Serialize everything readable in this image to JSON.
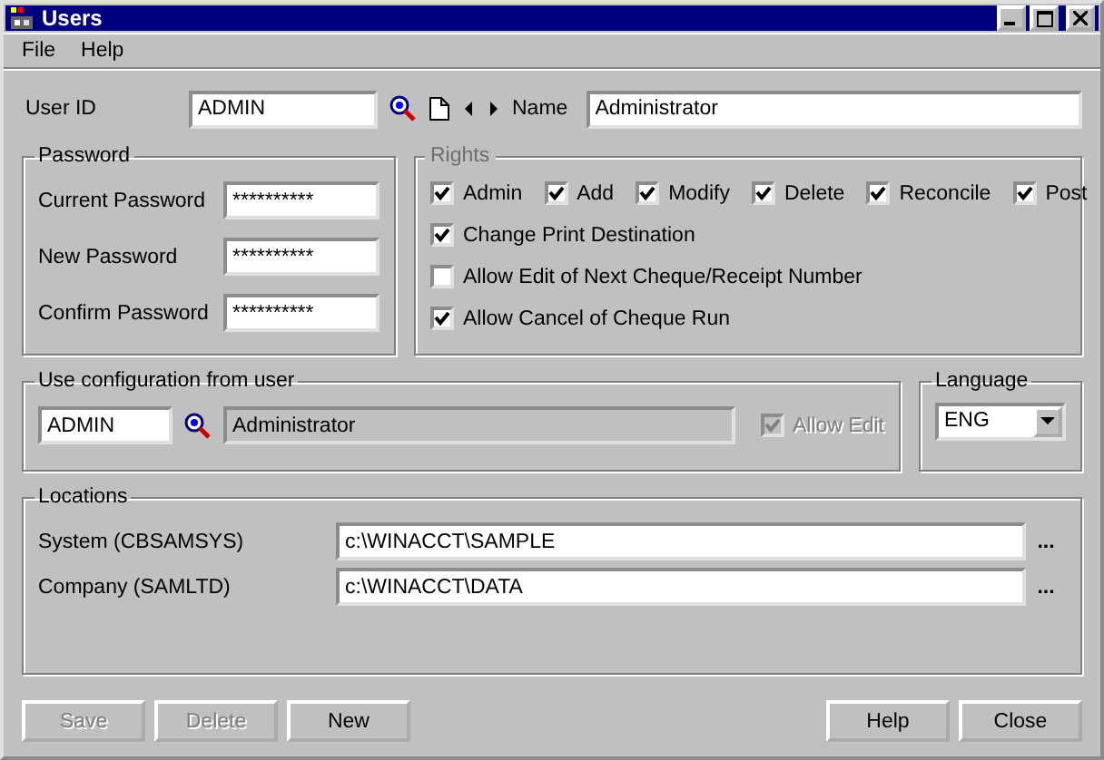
{
  "window": {
    "title": "Users"
  },
  "menu": [
    {
      "label": "File"
    },
    {
      "label": "Help"
    }
  ],
  "user": {
    "label": "User ID",
    "value": "ADMIN",
    "name_label": "Name",
    "name_value": "Administrator"
  },
  "password": {
    "title": "Password",
    "fields": [
      {
        "label": "Current Password",
        "value": "**********"
      },
      {
        "label": "New Password",
        "value": "**********"
      },
      {
        "label": "Confirm Password",
        "value": "**********"
      }
    ]
  },
  "rights": {
    "title": "Rights",
    "disabled": true,
    "top": [
      {
        "label": "Admin",
        "checked": true
      },
      {
        "label": "Add",
        "checked": true
      },
      {
        "label": "Modify",
        "checked": true
      },
      {
        "label": "Delete",
        "checked": true
      },
      {
        "label": "Reconcile",
        "checked": true
      },
      {
        "label": "Post",
        "checked": true
      }
    ],
    "options": [
      {
        "label": "Change Print Destination",
        "checked": true
      },
      {
        "label": "Allow Edit of Next Cheque/Receipt Number",
        "checked": false
      },
      {
        "label": "Allow Cancel of Cheque Run",
        "checked": true
      }
    ]
  },
  "config": {
    "title": "Use configuration from user",
    "user_id": "ADMIN",
    "user_name": "Administrator",
    "allow_edit": {
      "label": "Allow Edit",
      "checked": true,
      "disabled": true
    }
  },
  "language": {
    "title": "Language",
    "value": "ENG"
  },
  "locations": {
    "title": "Locations",
    "rows": [
      {
        "label": "System (CBSAMSYS)",
        "value": "c:\\WINACCT\\SAMPLE",
        "browse": "..."
      },
      {
        "label": "Company (SAMLTD)",
        "value": "c:\\WINACCT\\DATA",
        "browse": "..."
      }
    ]
  },
  "buttons_left": [
    {
      "label": "Save",
      "disabled": true
    },
    {
      "label": "Delete",
      "disabled": true
    },
    {
      "label": "New",
      "disabled": false
    }
  ],
  "buttons_right": [
    {
      "label": "Help",
      "disabled": false
    },
    {
      "label": "Close",
      "disabled": false
    }
  ]
}
